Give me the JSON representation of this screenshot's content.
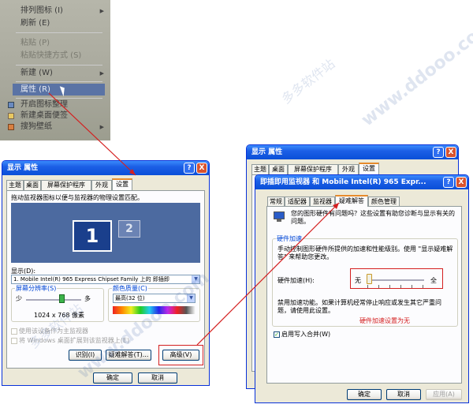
{
  "context_menu": {
    "items": [
      {
        "label": "排列图标 (I)",
        "has_submenu": true,
        "disabled": false
      },
      {
        "label": "刷新 (E)",
        "has_submenu": false,
        "disabled": false
      },
      {
        "label": "粘贴 (P)",
        "has_submenu": false,
        "disabled": true
      },
      {
        "label": "粘贴快捷方式 (S)",
        "has_submenu": false,
        "disabled": true
      },
      {
        "label": "新建 (W)",
        "has_submenu": true,
        "disabled": false
      },
      {
        "label": "属性 (R)",
        "has_submenu": false,
        "disabled": false,
        "selected": true
      },
      {
        "label": "开启图标整理",
        "has_submenu": false,
        "disabled": false
      },
      {
        "label": "新建桌面便签",
        "has_submenu": false,
        "disabled": false
      },
      {
        "label": "搜狗壁纸",
        "has_submenu": true,
        "disabled": false
      }
    ]
  },
  "watermarks": [
    "多多软件站",
    "www.ddooo.com",
    "多多软件站",
    "www.ddooo.com"
  ],
  "left_window": {
    "title": "显示 属性",
    "help": "?",
    "close": "X",
    "tabs": [
      "主题",
      "桌面",
      "屏幕保护程序",
      "外观",
      "设置"
    ],
    "active_tab": "设置",
    "instruction": "拖动监视器图标以便与监视器的物理设置匹配。",
    "monitors": [
      "1",
      "2"
    ],
    "display_label": "显示(D):",
    "display_value": "1. Mobile Intel(R) 965 Express Chipset Family 上的 即插即",
    "resolution_group": "屏幕分辨率(S)",
    "res_less": "少",
    "res_more": "多",
    "resolution_value": "1024 x 768 像素",
    "color_group": "颜色质量(C)",
    "color_value": "最高(32 位)",
    "check_primary": "使用该设备作为主监视器",
    "check_extend": "将 Windows 桌面扩展到该监视器上(E)",
    "btn_identify": "识别(I)",
    "btn_troubleshoot": "疑难解答(T)...",
    "btn_advanced": "高级(V)",
    "btn_ok": "确定",
    "btn_cancel": "取消"
  },
  "right_back_window": {
    "title": "显示 属性",
    "help": "?",
    "close": "X",
    "tabs": [
      "主题",
      "桌面",
      "屏幕保护程序",
      "外观",
      "设置"
    ],
    "btn_ok": "确定",
    "btn_cancel": "取消",
    "btn_apply": "应用(A)"
  },
  "right_front_window": {
    "title": "即插即用监视器 和 Mobile Intel(R) 965 Expr...",
    "help": "?",
    "close": "X",
    "tabs_row1": [
      "常规",
      "适配器",
      "监视器",
      "疑难解答",
      "颜色管理"
    ],
    "active_tab": "疑难解答",
    "intro": "您的图形硬件有问题吗？这些设置有助您诊断与显示有关的问题。",
    "hw_group": "硬件加速",
    "hw_desc": "手动控制图形硬件所提供的加速和性能级别。使用 \"显示疑难解答\" 来帮助您更改。",
    "hw_label": "硬件加速(H):",
    "slider_min": "无",
    "slider_max": "全",
    "slider_level": 0,
    "status_text": "禁用加速功能。如果计算机经常停止响应或发生其它严重问题，请使用此设置。",
    "annotation": "硬件加速设置为无",
    "annotation_color": "#d42020",
    "check_write_combining": "启用写入合并(W)",
    "btn_ok": "确定",
    "btn_cancel": "取消",
    "btn_apply": "应用(A)"
  }
}
